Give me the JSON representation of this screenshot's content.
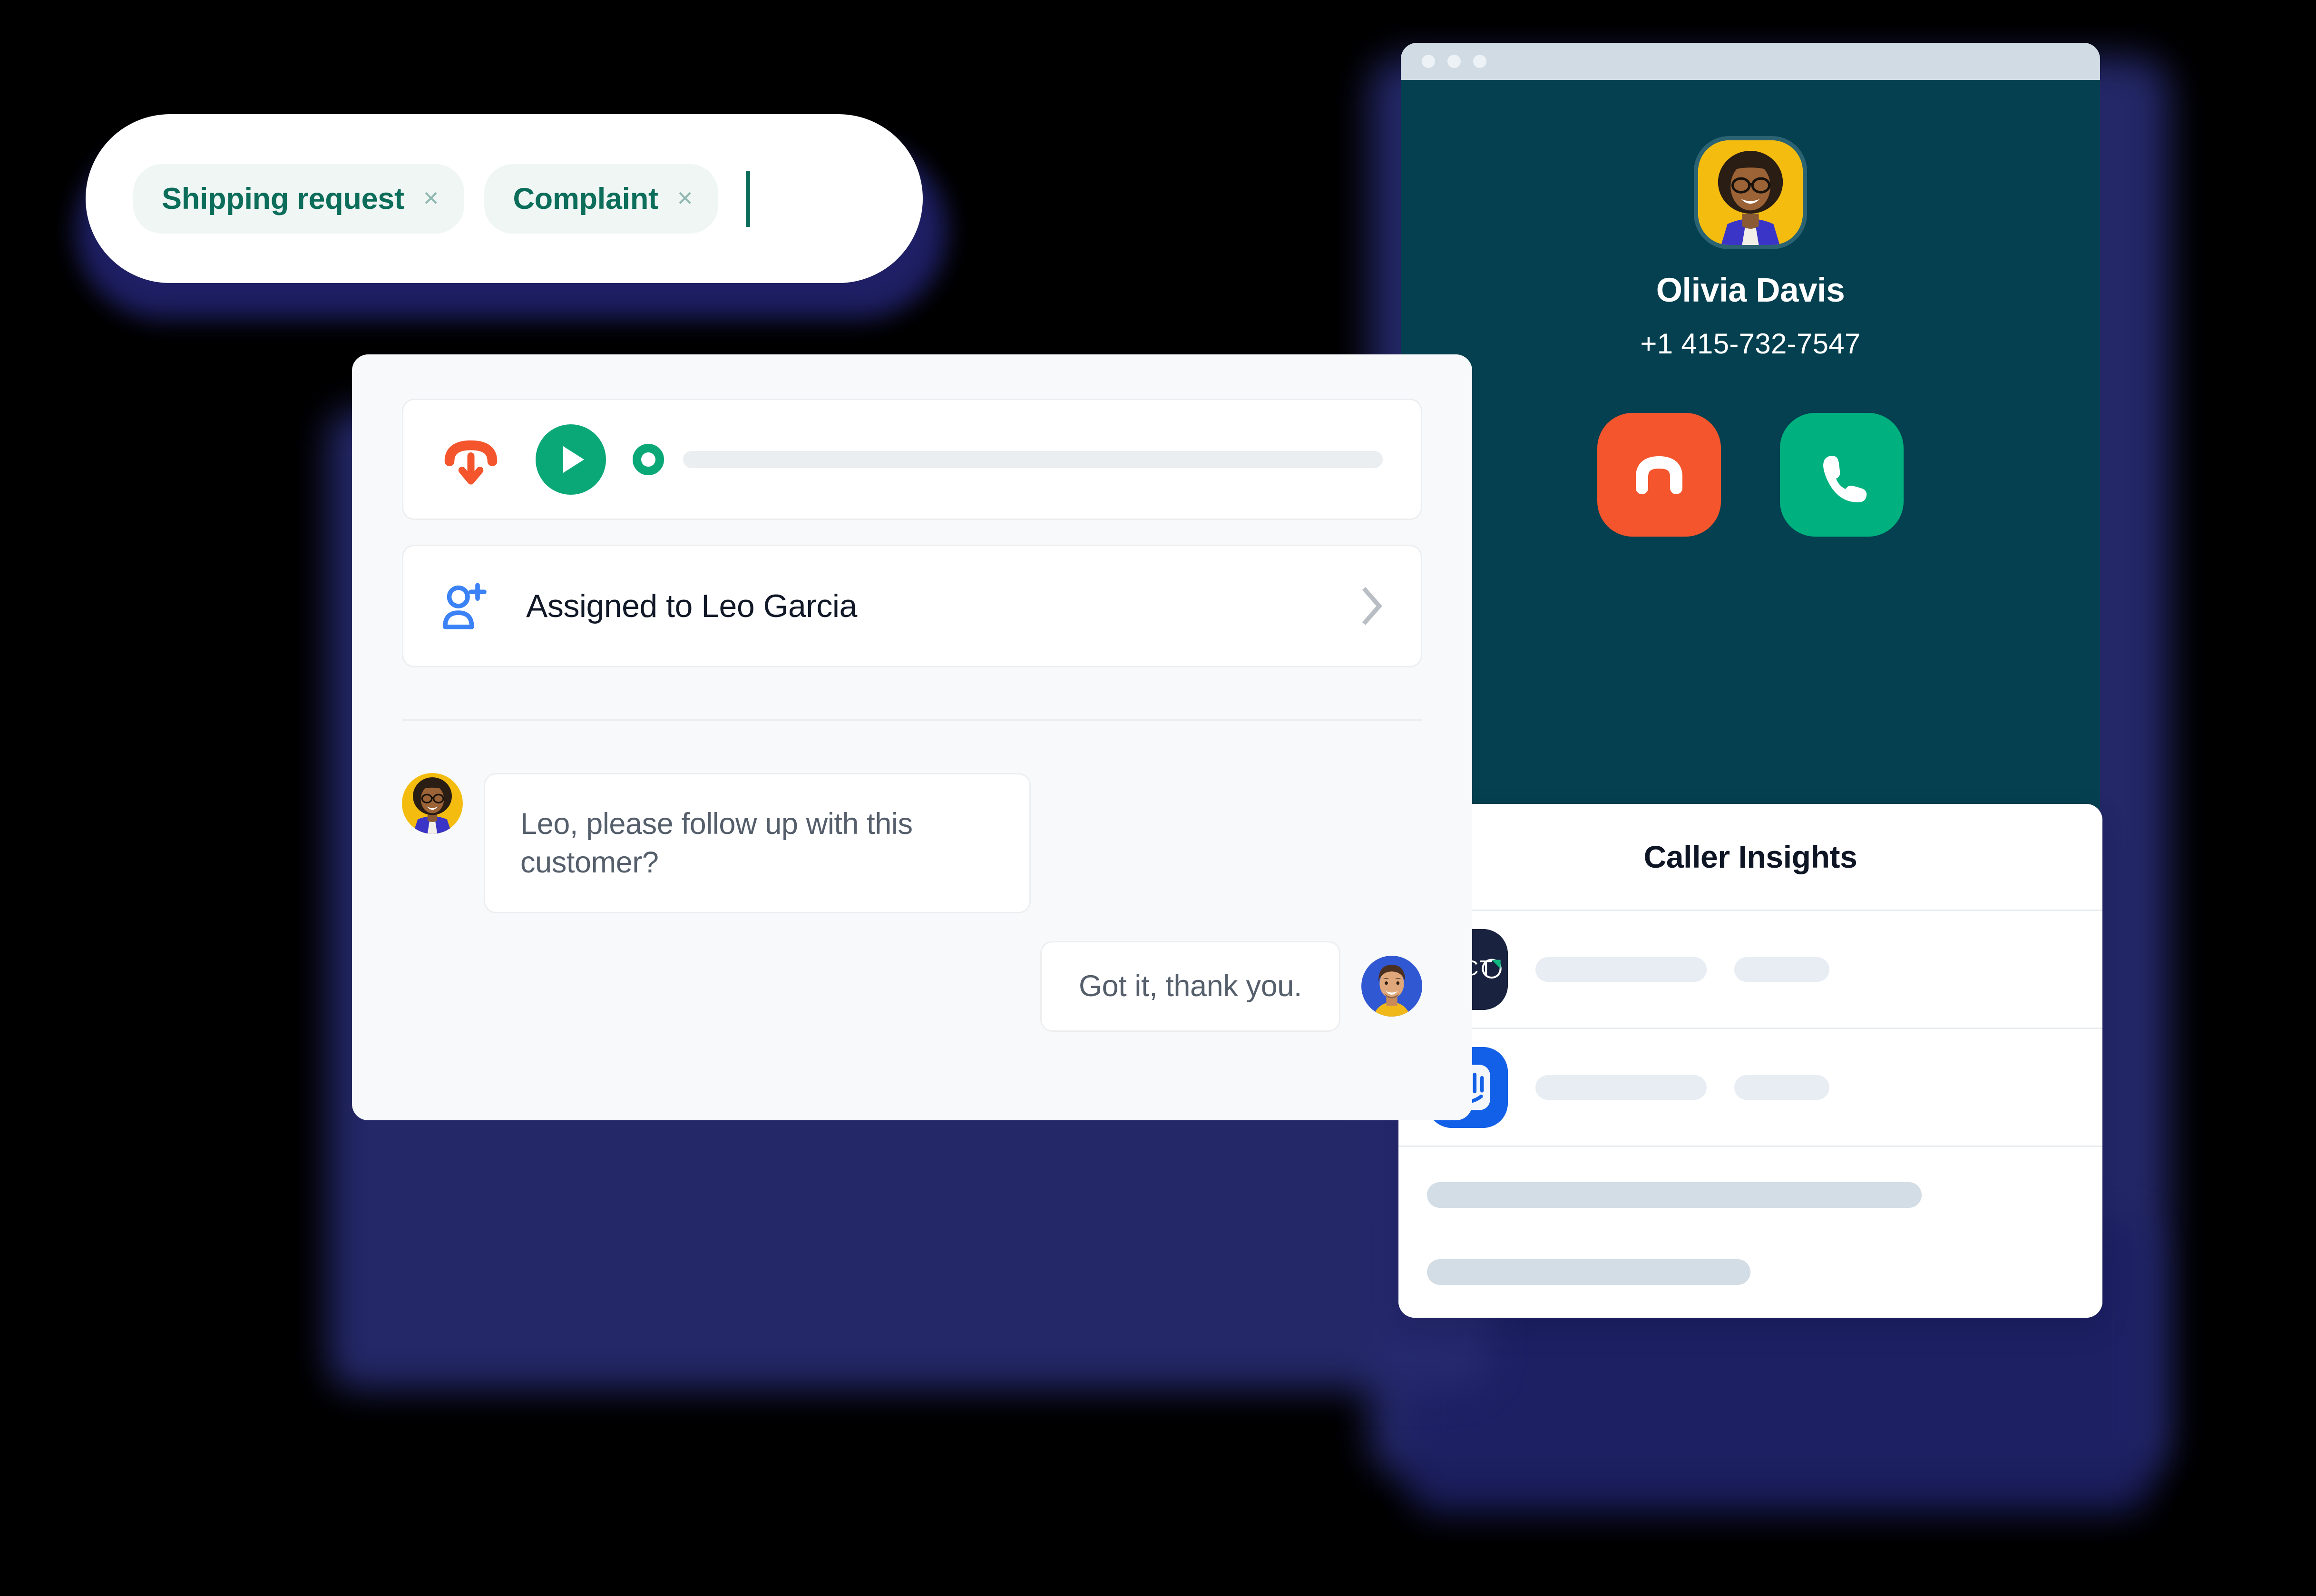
{
  "tag_bar": {
    "tags": [
      {
        "label": "Shipping request",
        "remove_icon": "×"
      },
      {
        "label": "Complaint",
        "remove_icon": "×"
      }
    ],
    "caret": ""
  },
  "call_window": {
    "traffic_lights": [
      "close-dot",
      "minimize-dot",
      "maximize-dot"
    ],
    "caller": {
      "name": "Olivia Davis",
      "phone": "+1 415-732-7547",
      "avatar_alt": "Olivia Davis portrait"
    },
    "actions": {
      "decline_label": "Decline call",
      "accept_label": "Accept call"
    },
    "colors": {
      "window_bg": "#04404f",
      "titlebar": "#d0dbe3",
      "decline": "#f4552c",
      "accept": "#00b07e",
      "avatar_bg": "#f5bc10"
    }
  },
  "insights": {
    "title": "Caller Insights",
    "rows": [
      {
        "logo_name": "vecto-logo",
        "logo_text": "ECTO",
        "logo_bg": "#19223f"
      },
      {
        "logo_name": "intercom-logo",
        "logo_text": "",
        "logo_bg": "#1360e8"
      }
    ]
  },
  "chat_card": {
    "player": {
      "status_icon": "incoming-call-icon",
      "play_icon": "play-icon",
      "progress_value": 0,
      "colors": {
        "play": "#0aa877",
        "incoming": "#f4552c",
        "track": "#eaeef1"
      }
    },
    "assignment": {
      "icon": "add-user-icon",
      "label": "Assigned to Leo Garcia",
      "chevron": "chevron-right-icon",
      "icon_color": "#3b82f6"
    },
    "messages": [
      {
        "author": "Olivia Davis",
        "side": "left",
        "text": "Leo, please follow up with this customer?",
        "avatar_alt": "Olivia Davis avatar"
      },
      {
        "author": "Leo Garcia",
        "side": "right",
        "text": "Got it, thank you.",
        "avatar_alt": "Leo Garcia avatar"
      }
    ]
  }
}
